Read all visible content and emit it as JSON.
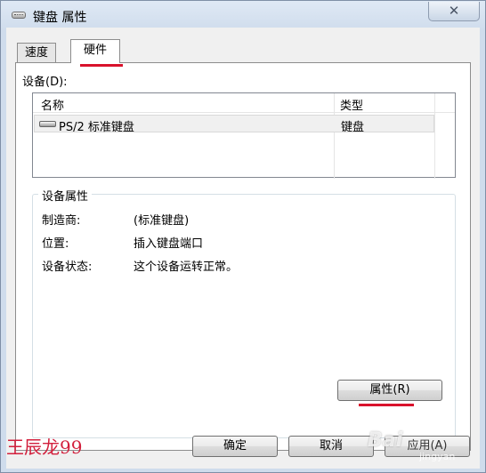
{
  "window": {
    "title": "键盘 属性",
    "close_glyph": "✕"
  },
  "tabs": [
    {
      "label": "速度",
      "selected": false
    },
    {
      "label": "硬件",
      "selected": true
    }
  ],
  "devices": {
    "label": "设备(D):",
    "columns": [
      "名称",
      "类型"
    ],
    "rows": [
      {
        "name": "PS/2 标准键盘",
        "type": "键盘",
        "icon": "keyboard-icon"
      }
    ]
  },
  "device_properties": {
    "title": "设备属性",
    "fields": [
      {
        "label": "制造商:",
        "value": "(标准键盘)"
      },
      {
        "label": "位置:",
        "value": "插入键盘端口"
      },
      {
        "label": "设备状态:",
        "value": "这个设备运转正常。"
      }
    ],
    "properties_button": "属性(R)"
  },
  "buttons": {
    "ok": "确定",
    "cancel": "取消",
    "apply": "应用(A)"
  },
  "watermark": {
    "author": "王辰龙99",
    "brand": "Bai",
    "site": "jingyan"
  },
  "colors": {
    "highlight": "#d9122c",
    "window_bg": "#cfdcec",
    "dialog_bg": "#f0f0f0"
  }
}
